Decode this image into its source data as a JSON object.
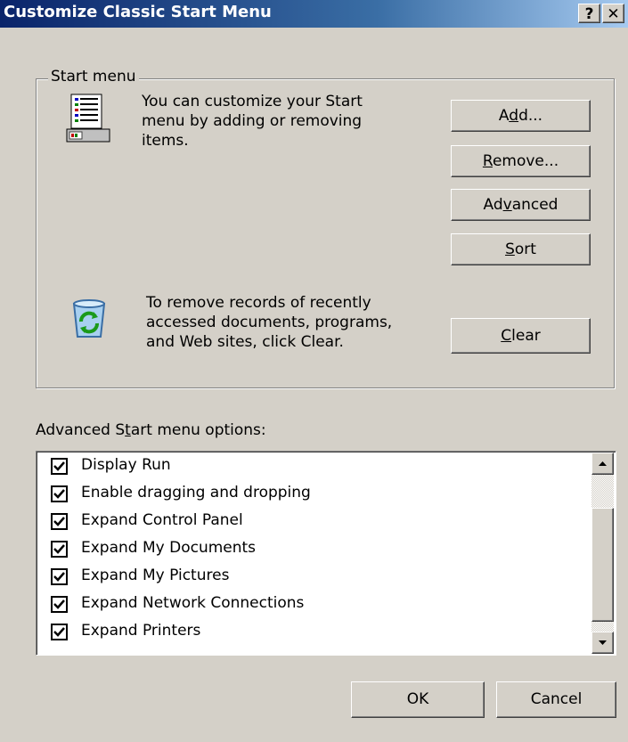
{
  "window": {
    "title": "Customize Classic Start Menu",
    "help_btn": "?",
    "close_btn": "✕"
  },
  "start_menu": {
    "legend": "Start menu",
    "customize_lines": [
      "You can customize your Start",
      "menu by adding or removing",
      "items."
    ],
    "clear_lines": [
      "To remove records of recently",
      "accessed documents, programs,",
      "and Web sites, click Clear."
    ],
    "add": {
      "pre": "A",
      "acc": "d",
      "post": "d..."
    },
    "remove": {
      "pre": "",
      "acc": "R",
      "post": "emove..."
    },
    "advanced": {
      "pre": "Ad",
      "acc": "v",
      "post": "anced"
    },
    "sort": {
      "pre": "",
      "acc": "S",
      "post": "ort"
    },
    "clear": {
      "pre": "",
      "acc": "C",
      "post": "lear"
    }
  },
  "advanced_options": {
    "label": {
      "pre": "Advanced S",
      "acc": "t",
      "post": "art menu options:"
    },
    "items": [
      {
        "label": "Display Run",
        "checked": true
      },
      {
        "label": "Enable dragging and dropping",
        "checked": true
      },
      {
        "label": "Expand Control Panel",
        "checked": true
      },
      {
        "label": "Expand My Documents",
        "checked": true
      },
      {
        "label": "Expand My Pictures",
        "checked": true
      },
      {
        "label": "Expand Network Connections",
        "checked": true
      },
      {
        "label": "Expand Printers",
        "checked": true
      }
    ]
  },
  "footer": {
    "ok": "OK",
    "cancel": "Cancel"
  },
  "icons": {
    "start_menu": "start-menu-list-icon",
    "recycle": "recycle-bin-icon",
    "checkbox": "checkmark-icon",
    "scroll_up": "arrow-up-icon",
    "scroll_down": "arrow-down-icon"
  }
}
